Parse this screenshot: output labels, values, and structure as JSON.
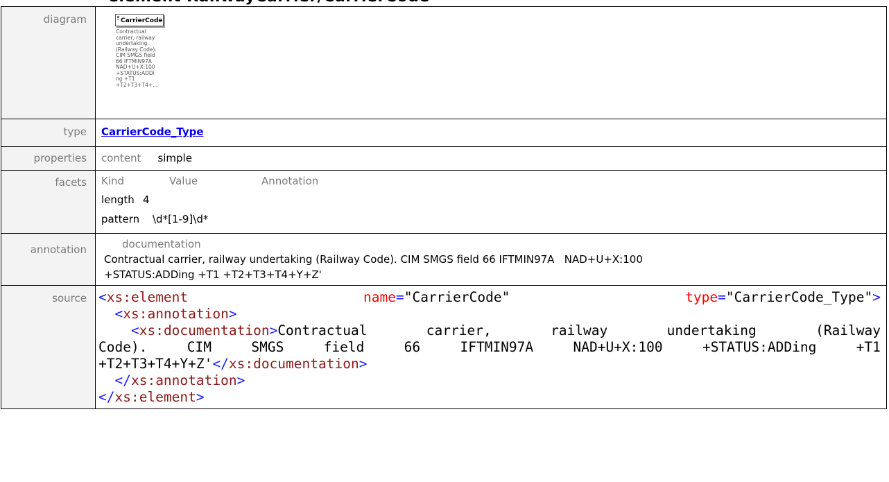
{
  "rows": {
    "diagram": {
      "label": "diagram",
      "box_title": "CarrierCode",
      "box_text": "Contractual\ncarrier, railway\nundertaking\n(Railway Code).\nCIM SMGS field\n66 IFTMIN97A\nNAD+U+X:100\n+STATUS:ADDi\nng +T1\n+T2+T3+T4+..."
    },
    "type": {
      "label": "type",
      "link": "CarrierCode_Type"
    },
    "properties": {
      "label": "properties",
      "key": "content",
      "value": "simple"
    },
    "facets": {
      "label": "facets",
      "headers": [
        "Kind",
        "Value",
        "Annotation"
      ],
      "rows": [
        {
          "kind": "length",
          "value": "4"
        },
        {
          "kind": "pattern",
          "value": "\\d*[1-9]\\d*"
        }
      ]
    },
    "annotation": {
      "label": "annotation",
      "key": "documentation",
      "line1": "Contractual carrier, railway undertaking (Railway Code). CIM SMGS field 66 IFTMIN97A   NAD+U+X:100",
      "line2": "+STATUS:ADDing +T1 +T2+T3+T4+Y+Z'"
    },
    "source": {
      "label": "source",
      "open_lt": "<",
      "tag_element": "xs:element",
      "attr_name": "name",
      "val_name": "\"CarrierCode\"",
      "attr_type": "type",
      "val_type": "\"CarrierCode_Type\"",
      "gt": ">",
      "eq": "=",
      "tag_annotation": "xs:annotation",
      "tag_documentation": "xs:documentation",
      "doc_line1_words": [
        "Contractual",
        "carrier,",
        "railway",
        "undertaking",
        "(Railway"
      ],
      "doc_line2_words": [
        "Code).",
        "CIM",
        "SMGS",
        "field",
        "66",
        "IFTMIN97A",
        "NAD+U+X:100",
        "+STATUS:ADDing",
        "+T1"
      ],
      "doc_line3_text": "+T2+T3+T4+Y+Z'",
      "close_doc": "</",
      "close_annotation_lt": "</",
      "close_element_lt": "</"
    }
  }
}
